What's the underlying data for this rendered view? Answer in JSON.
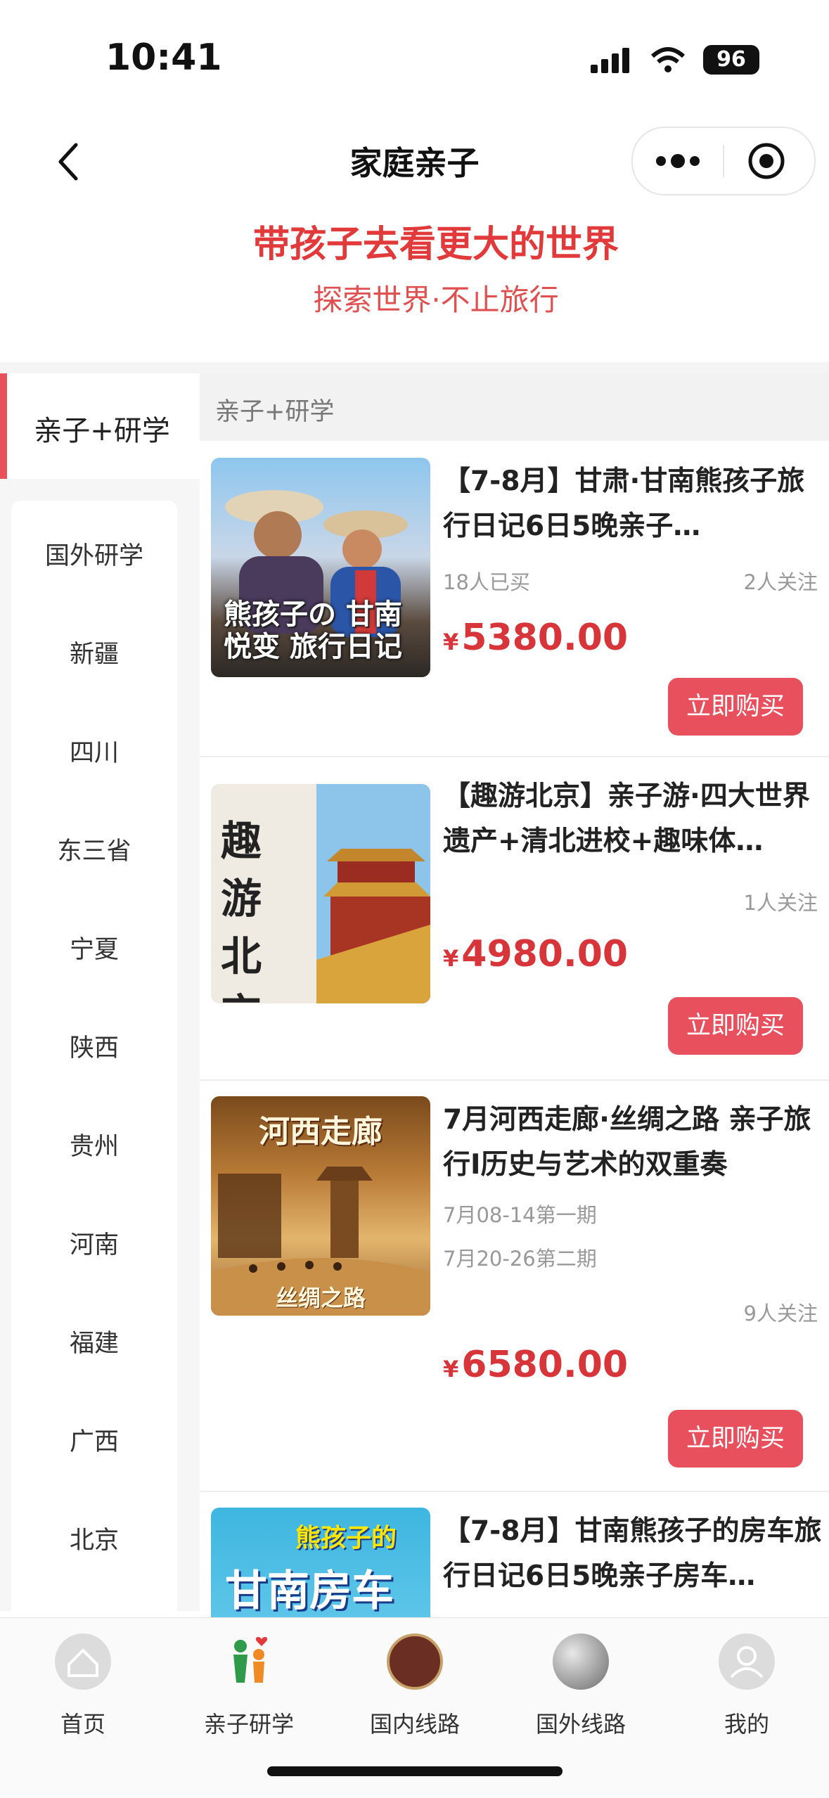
{
  "status": {
    "time": "10:41",
    "battery": "96"
  },
  "nav": {
    "title": "家庭亲子"
  },
  "banner": {
    "title": "带孩子去看更大的世界",
    "subtitle": "探索世界·不止旅行"
  },
  "sidebar": {
    "active": "亲子+研学",
    "items": [
      "国外研学",
      "新疆",
      "四川",
      "东三省",
      "宁夏",
      "陕西",
      "贵州",
      "河南",
      "福建",
      "广西",
      "北京"
    ]
  },
  "content": {
    "header": "亲子+研学",
    "products": [
      {
        "title": "【7-8月】甘肃·甘南熊孩子旅行日记6日5晚亲子…",
        "bought": "18人已买",
        "follow": "2人关注",
        "currency": "¥",
        "price": "5380.00",
        "buy_label": "立即购买",
        "image_text": "熊孩子の 甘南悦变 旅行日记"
      },
      {
        "title": "【趣游北京】亲子游·四大世界遗产+清北进校+趣味体…",
        "follow": "1人关注",
        "currency": "¥",
        "price": "4980.00",
        "buy_label": "立即购买",
        "image_text": "趣 游 北京"
      },
      {
        "title": "7月河西走廊·丝绸之路 亲子旅行I历史与艺术的双重奏",
        "period1": "7月08-14第一期",
        "period2": "7月20-26第二期",
        "follow": "9人关注",
        "currency": "¥",
        "price": "6580.00",
        "buy_label": "立即购买",
        "image_text": "河西走廊",
        "image_sub": "丝绸之路"
      },
      {
        "title": "【7-8月】甘南熊孩子的房车旅行日记6日5晚亲子房车…",
        "image_text": "甘南房车",
        "image_sub": "熊孩子的"
      }
    ]
  },
  "tabbar": [
    {
      "label": "首页",
      "icon": "home-icon"
    },
    {
      "label": "亲子研学",
      "icon": "family-icon"
    },
    {
      "label": "国内线路",
      "icon": "china-seal-icon"
    },
    {
      "label": "国外线路",
      "icon": "globe-icon"
    },
    {
      "label": "我的",
      "icon": "user-icon"
    }
  ]
}
